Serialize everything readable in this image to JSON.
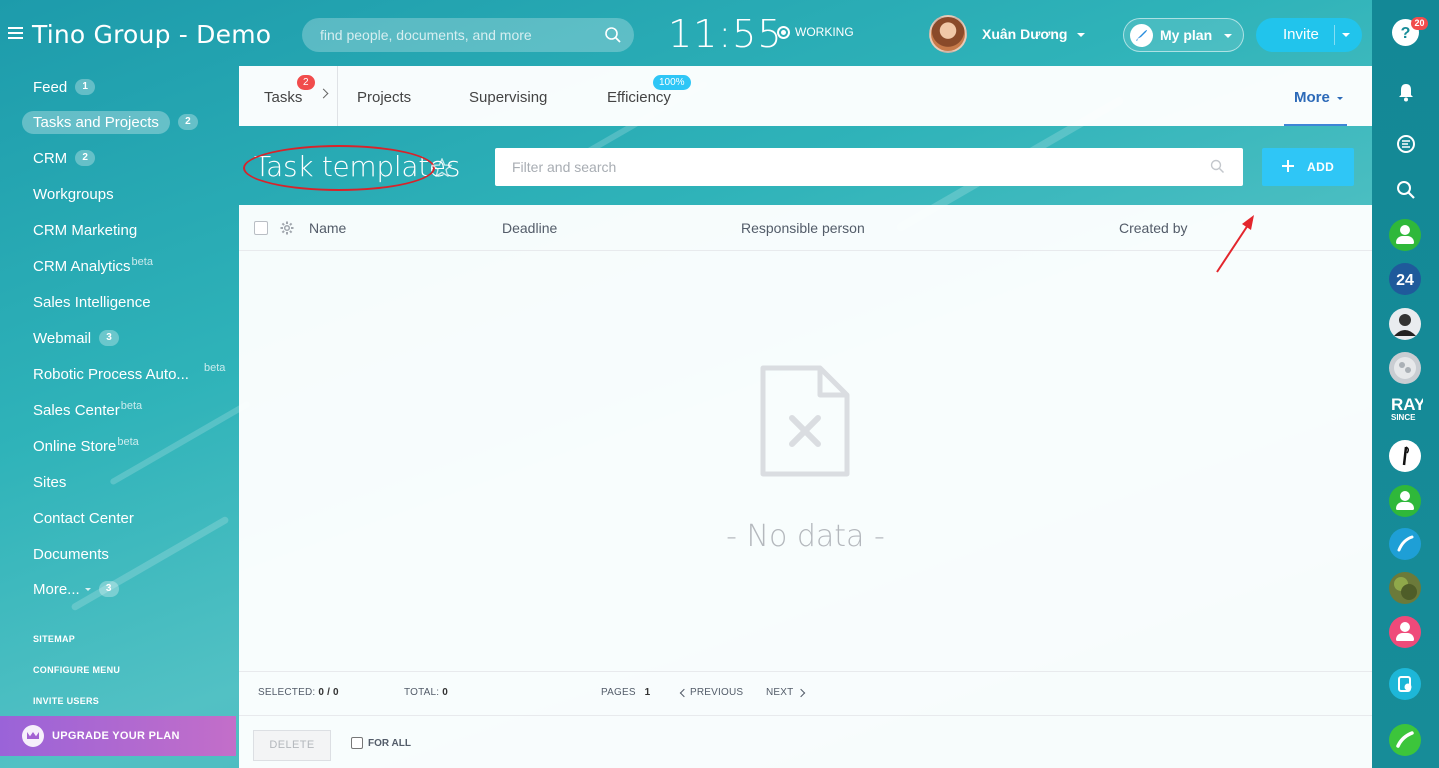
{
  "header": {
    "brand": "Tino Group - Demo",
    "search_placeholder": "find people, documents, and more",
    "clock": "11:55",
    "status": "WORKING",
    "user_name": "Xuân Dương",
    "my_plan": "My plan",
    "invite": "Invite"
  },
  "sidebar": {
    "items": [
      {
        "label": "Feed",
        "badge": "1"
      },
      {
        "label": "Tasks and Projects",
        "badge": "2"
      },
      {
        "label": "CRM",
        "badge": "2"
      },
      {
        "label": "Workgroups"
      },
      {
        "label": "CRM Marketing"
      },
      {
        "label": "CRM Analytics",
        "sup": "beta"
      },
      {
        "label": "Sales Intelligence"
      },
      {
        "label": "Webmail",
        "badge": "3"
      },
      {
        "label": "Robotic Process Auto...",
        "sup": "beta"
      },
      {
        "label": "Sales Center",
        "sup": "beta"
      },
      {
        "label": "Online Store",
        "sup": "beta"
      },
      {
        "label": "Sites"
      },
      {
        "label": "Contact Center"
      },
      {
        "label": "Documents"
      },
      {
        "label": "More...",
        "badge": "3"
      }
    ],
    "footer_links": [
      "SITEMAP",
      "CONFIGURE MENU",
      "INVITE USERS"
    ],
    "upgrade": "UPGRADE YOUR PLAN"
  },
  "tabs": {
    "items": [
      {
        "label": "Tasks",
        "badge": "2"
      },
      {
        "label": "Projects"
      },
      {
        "label": "Supervising"
      },
      {
        "label": "Efficiency",
        "badge": "100%"
      }
    ],
    "more": "More"
  },
  "page": {
    "title": "Task templates",
    "filter_placeholder": "Filter and search",
    "add_button": "ADD"
  },
  "grid": {
    "columns": [
      "Name",
      "Deadline",
      "Responsible person",
      "Created by"
    ],
    "empty_text": "- No data -",
    "footer": {
      "selected_label": "SELECTED:",
      "selected_value": "0 / 0",
      "total_label": "TOTAL:",
      "total_value": "0",
      "pages_label": "PAGES",
      "pages_value": "1",
      "previous": "PREVIOUS",
      "next": "NEXT"
    },
    "delete_button": "DELETE",
    "for_all": "FOR ALL"
  },
  "rightbar": {
    "help_badge": "20",
    "bitrix_label": "24",
    "ray_label": "RAY",
    "ray_sub": "SINCE"
  },
  "colors": {
    "accent": "#2fc6f6",
    "badge_red": "#f14c4c",
    "annotation_red": "#d8232a",
    "upgrade": "#a463d3"
  }
}
